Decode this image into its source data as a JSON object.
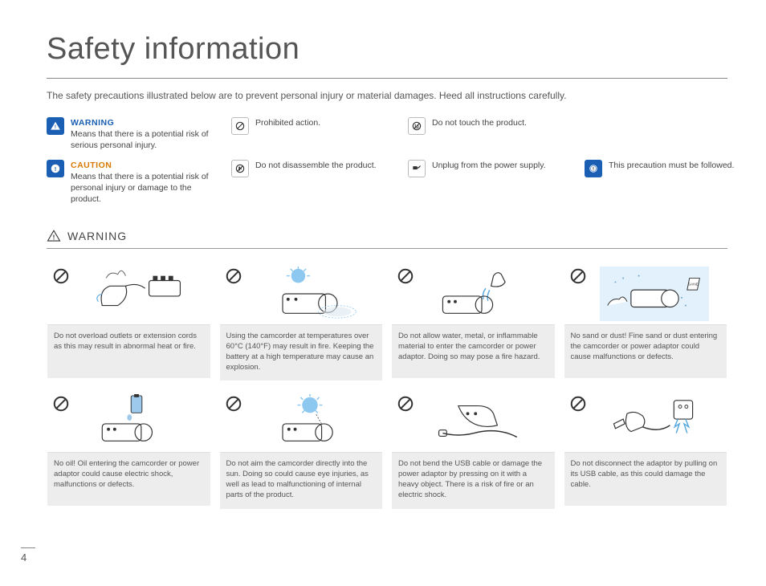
{
  "title": "Safety information",
  "intro": "The safety precautions illustrated below are to prevent personal injury or material damages. Heed all instructions carefully.",
  "legend": {
    "warning": {
      "title": "WARNING",
      "desc": "Means that there is a potential risk of serious personal injury."
    },
    "caution": {
      "title": "CAUTION",
      "desc": "Means that there is a potential risk of personal injury or damage to the product."
    },
    "prohibited": "Prohibited action.",
    "disassemble": "Do not disassemble the product.",
    "notouch": "Do not touch the product.",
    "unplug": "Unplug from the power supply.",
    "must": "This precaution must be followed."
  },
  "warning_section_label": "WARNING",
  "cards": [
    {
      "text": "Do not overload outlets or extension cords as this may result in abnormal heat or fire."
    },
    {
      "text": "Using the camcorder at temperatures over 60°C (140°F) may result in fire. Keeping the battery at a high temperature may cause an explosion."
    },
    {
      "text": "Do not allow water, metal, or inflammable material to enter the camcorder or power adaptor. Doing so may pose a fire hazard."
    },
    {
      "text": "No sand or dust! Fine sand or dust entering the camcorder or power adaptor could cause malfunctions or defects."
    },
    {
      "text": "No oil! Oil entering the camcorder or power adaptor could cause electric shock, malfunctions or defects."
    },
    {
      "text": "Do not aim the camcorder directly into the sun. Doing so could cause eye injuries, as well as lead to malfunctioning of internal parts of the product."
    },
    {
      "text": "Do not bend the USB cable or damage the power adaptor by pressing on it with a heavy object. There is a risk of fire or an electric shock."
    },
    {
      "text": "Do not disconnect the adaptor by pulling on its USB cable, as this could damage the cable."
    }
  ],
  "page_number": "4"
}
